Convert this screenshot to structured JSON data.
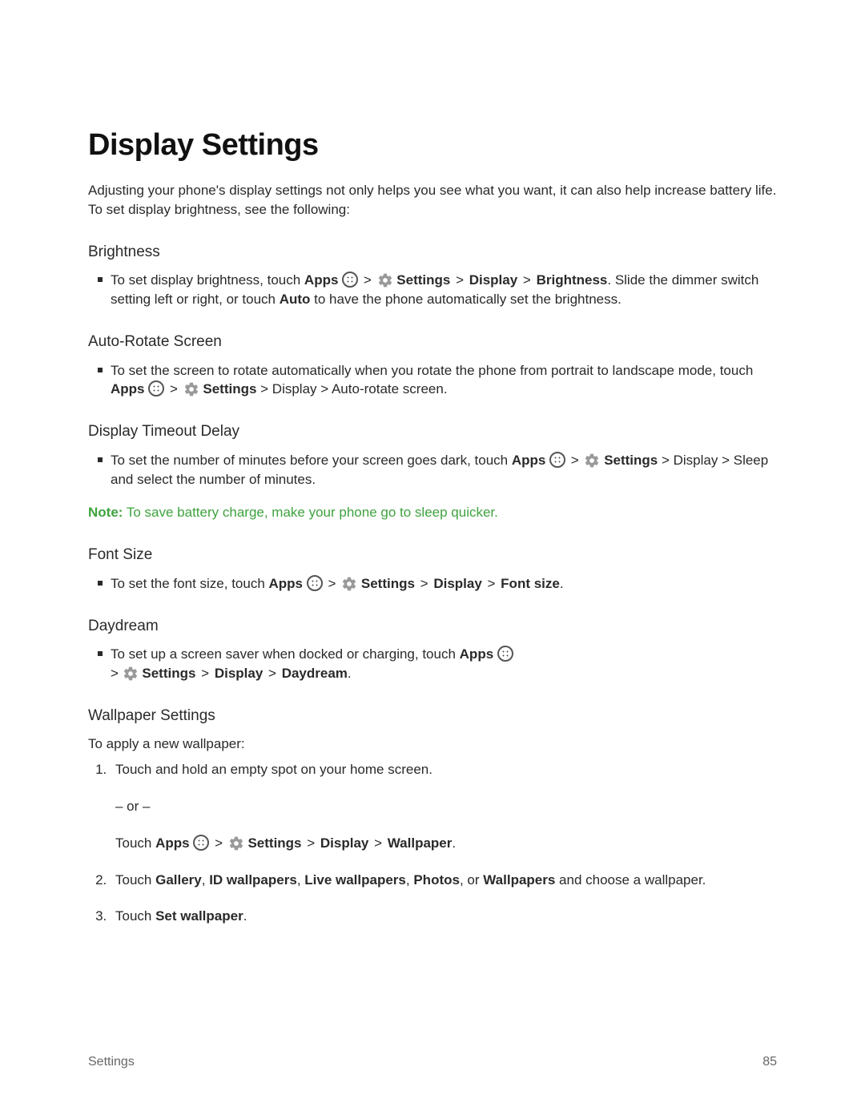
{
  "title": "Display Settings",
  "intro": "Adjusting your phone's display settings not only helps you see what you want, it can also help increase battery life. To set display brightness, see the following:",
  "sections": {
    "brightness": {
      "heading": "Brightness",
      "item_pre": "To set display brightness, touch ",
      "apps": "Apps",
      "settings": "Settings",
      "display": "Display",
      "brightness": "Brightness",
      "tail1": ". Slide the dimmer switch setting left or right, or touch ",
      "auto": "Auto",
      "tail2": " to have the phone automatically set the brightness."
    },
    "autorotate": {
      "heading": "Auto-Rotate Screen",
      "item_pre": "To set the screen to rotate automatically when you rotate the phone from portrait to landscape mode, touch ",
      "apps": "Apps",
      "settings": "Settings",
      "tail": " > Display > Auto-rotate screen."
    },
    "timeout": {
      "heading": "Display Timeout Delay",
      "item_pre": "To set the number of minutes before your screen goes dark, touch ",
      "apps": "Apps",
      "settings": "Settings",
      "tail": " > Display > Sleep and select the number of minutes."
    },
    "note": {
      "label": "Note:",
      "text": " To save battery charge, make your phone go to sleep quicker."
    },
    "fontsize": {
      "heading": "Font Size",
      "item_pre": "To set the font size, touch ",
      "apps": "Apps",
      "settings": "Settings",
      "display": "Display",
      "fontsize": "Font size",
      "period": "."
    },
    "daydream": {
      "heading": "Daydream",
      "item_pre": "To set up a screen saver when docked or charging, touch ",
      "apps": "Apps",
      "line2_sep": " > ",
      "settings": "Settings",
      "display": "Display",
      "daydream": "Daydream",
      "period": "."
    },
    "wallpaper": {
      "heading": "Wallpaper Settings",
      "intro": "To apply a new wallpaper:",
      "step1a": "Touch and hold an empty spot on your home screen.",
      "or": "– or –",
      "step1b_pre": "Touch ",
      "apps": "Apps",
      "settings": "Settings",
      "display": "Display",
      "wallpaper": "Wallpaper",
      "period": ".",
      "step2_pre": "Touch ",
      "step2_gallery": "Gallery",
      "step2_c1": ", ",
      "step2_id": "ID wallpapers",
      "step2_c2": ", ",
      "step2_live": "Live wallpapers",
      "step2_c3": ", ",
      "step2_photos": "Photos",
      "step2_c4": ", or ",
      "step2_wall": "Wallpapers",
      "step2_tail": " and choose a wallpaper.",
      "step3_pre": "Touch ",
      "step3_set": "Set wallpaper",
      "step3_period": "."
    }
  },
  "footer": {
    "section": "Settings",
    "page": "85"
  },
  "glyphs": {
    "gt": " > "
  }
}
